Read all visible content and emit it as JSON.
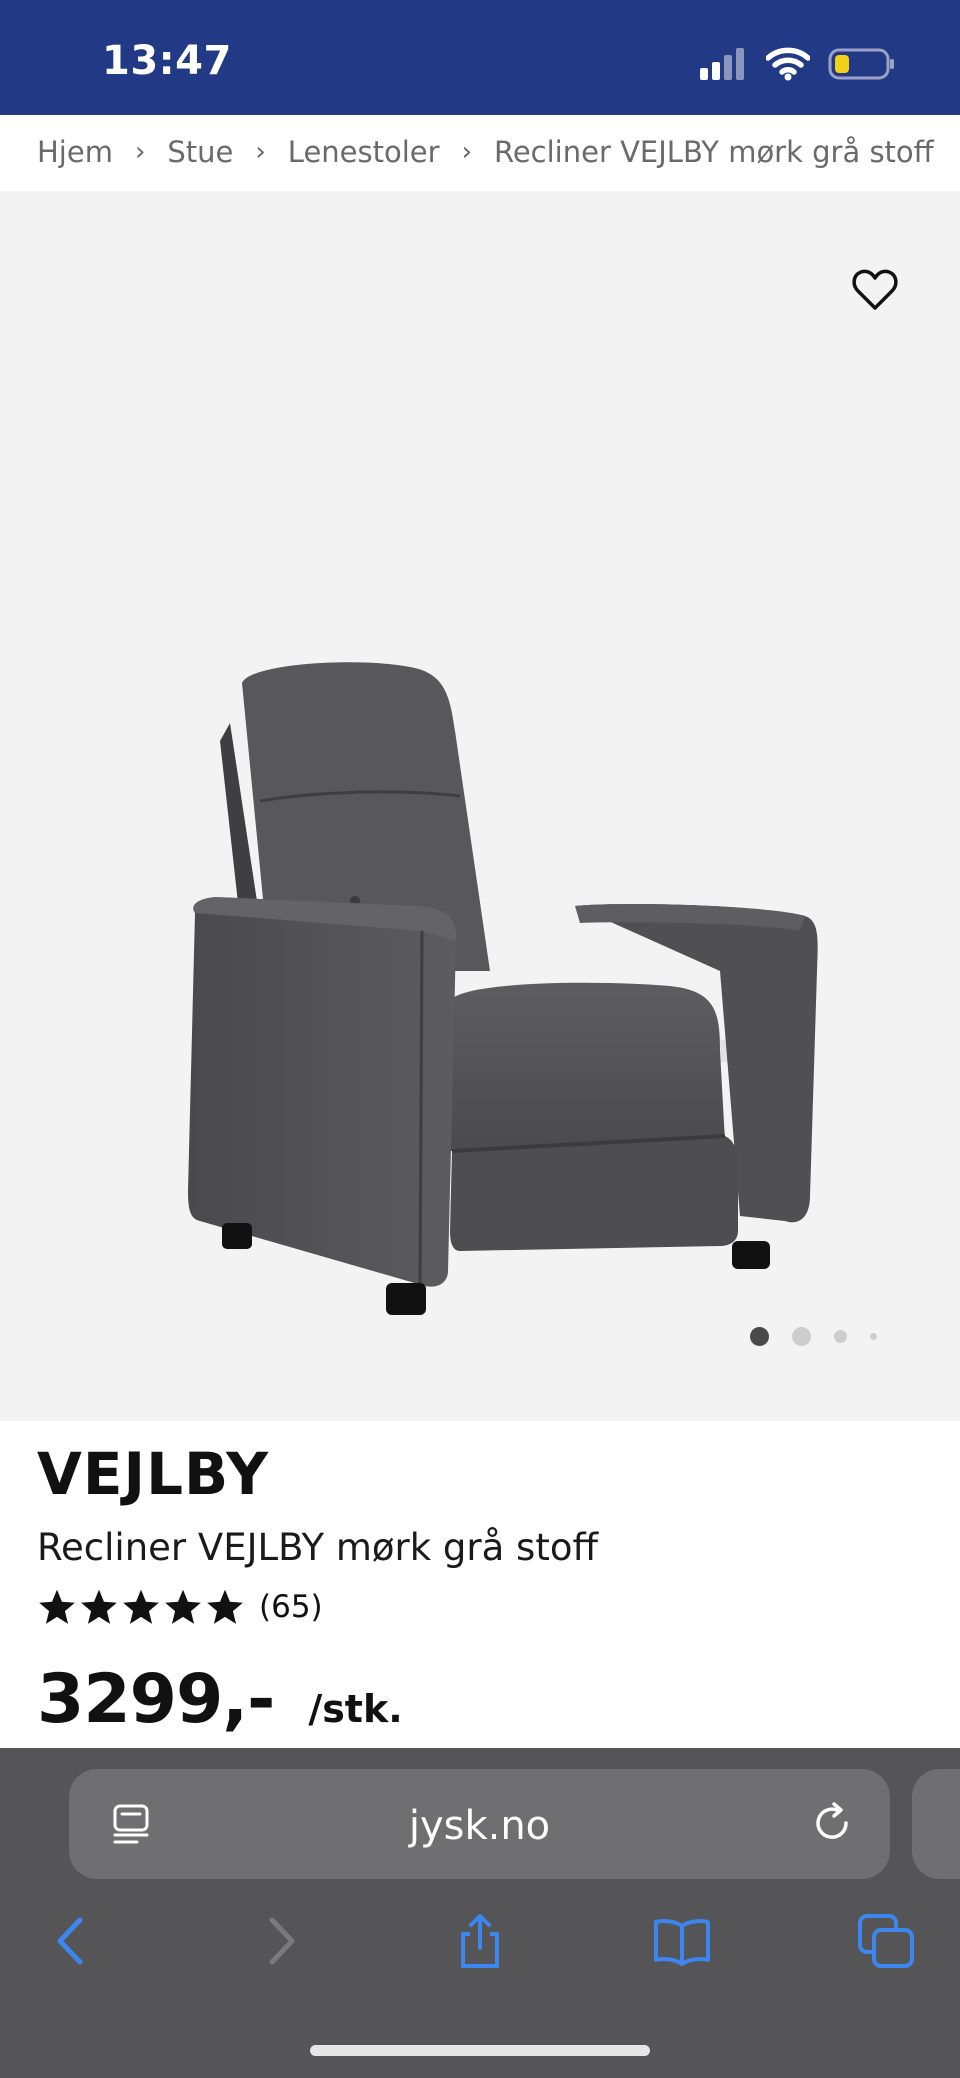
{
  "status_bar": {
    "time": "13:47",
    "icons": [
      "cellular-signal-icon",
      "wifi-icon",
      "battery-icon"
    ],
    "background": "#223a86"
  },
  "breadcrumb": {
    "items": [
      "Hjem",
      "Stue",
      "Lenestoler",
      "Recliner VEJLBY mørk grå stoff"
    ],
    "separator": "›"
  },
  "gallery": {
    "image_description": "chair-product-image",
    "total_images": 4,
    "active_index": 0,
    "favorite_icon": "heart-outline-icon"
  },
  "product": {
    "brand": "VEJLBY",
    "title": "Recliner VEJLBY mørk grå stoff",
    "rating_stars": 5,
    "review_count": "(65)",
    "price": "3299,-",
    "unit": "/stk."
  },
  "browser": {
    "url": "jysk.no",
    "toolbar": [
      "back-icon",
      "forward-icon",
      "share-icon",
      "bookmarks-icon",
      "tabs-icon"
    ],
    "accent": "#3c86f0"
  }
}
